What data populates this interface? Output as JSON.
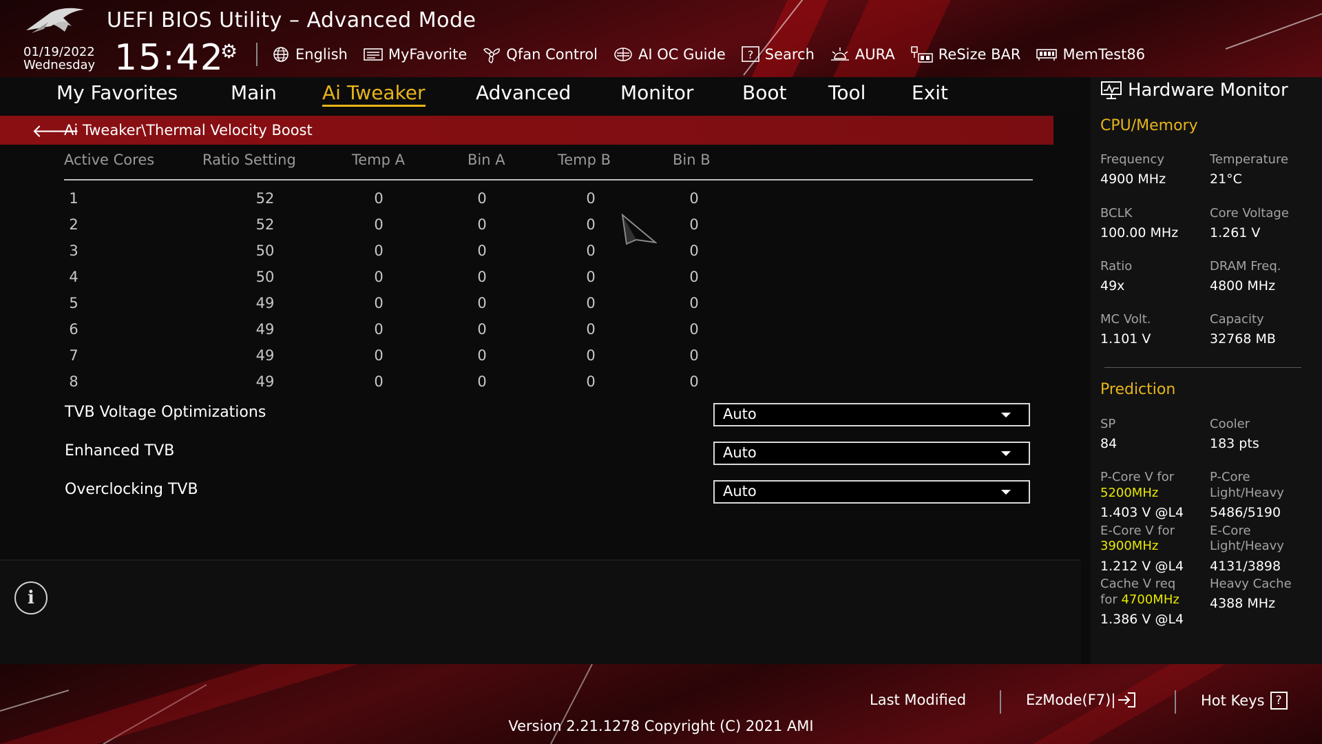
{
  "header": {
    "app_title": "UEFI BIOS Utility – Advanced Mode",
    "date": "01/19/2022",
    "weekday": "Wednesday",
    "time": "15:42",
    "toolbar": [
      {
        "label": "English",
        "icon": "globe-icon"
      },
      {
        "label": "MyFavorite",
        "icon": "favorite-icon"
      },
      {
        "label": "Qfan Control",
        "icon": "fan-icon"
      },
      {
        "label": "AI OC Guide",
        "icon": "ai-oc-guide-icon"
      },
      {
        "label": "Search",
        "icon": "search-icon"
      },
      {
        "label": "AURA",
        "icon": "aura-icon"
      },
      {
        "label": "ReSize BAR",
        "icon": "resize-bar-icon"
      },
      {
        "label": "MemTest86",
        "icon": "memtest-icon"
      }
    ]
  },
  "nav": {
    "tabs": [
      "My Favorites",
      "Main",
      "Ai Tweaker",
      "Advanced",
      "Monitor",
      "Boot",
      "Tool",
      "Exit"
    ],
    "active": "Ai Tweaker"
  },
  "breadcrumb": "Ai Tweaker\\Thermal Velocity Boost",
  "table": {
    "headers": [
      "Active Cores",
      "Ratio Setting",
      "Temp A",
      "Bin A",
      "Temp B",
      "Bin B"
    ],
    "rows": [
      [
        "1",
        "52",
        "0",
        "0",
        "0",
        "0"
      ],
      [
        "2",
        "52",
        "0",
        "0",
        "0",
        "0"
      ],
      [
        "3",
        "50",
        "0",
        "0",
        "0",
        "0"
      ],
      [
        "4",
        "50",
        "0",
        "0",
        "0",
        "0"
      ],
      [
        "5",
        "49",
        "0",
        "0",
        "0",
        "0"
      ],
      [
        "6",
        "49",
        "0",
        "0",
        "0",
        "0"
      ],
      [
        "7",
        "49",
        "0",
        "0",
        "0",
        "0"
      ],
      [
        "8",
        "49",
        "0",
        "0",
        "0",
        "0"
      ]
    ]
  },
  "settings": [
    {
      "label": "TVB Voltage Optimizations",
      "value": "Auto"
    },
    {
      "label": "Enhanced TVB",
      "value": "Auto"
    },
    {
      "label": "Overclocking TVB",
      "value": "Auto"
    }
  ],
  "hardware_monitor": {
    "title": "Hardware Monitor",
    "cpu_memory": {
      "section": "CPU/Memory",
      "frequency_label": "Frequency",
      "frequency": "4900 MHz",
      "temperature_label": "Temperature",
      "temperature": "21°C",
      "bclk_label": "BCLK",
      "bclk": "100.00 MHz",
      "core_voltage_label": "Core Voltage",
      "core_voltage": "1.261 V",
      "ratio_label": "Ratio",
      "ratio": "49x",
      "dram_freq_label": "DRAM Freq.",
      "dram_freq": "4800 MHz",
      "mc_volt_label": "MC Volt.",
      "mc_volt": "1.101 V",
      "capacity_label": "Capacity",
      "capacity": "32768 MB"
    },
    "prediction": {
      "section": "Prediction",
      "sp_label": "SP",
      "sp": "84",
      "cooler_label": "Cooler",
      "cooler": "183 pts",
      "pcore_v_label": "P-Core V for",
      "pcore_v_freq": "5200MHz",
      "pcore_v": "1.403 V @L4",
      "pcore_lh_label_1": "P-Core",
      "pcore_lh_label_2": "Light/Heavy",
      "pcore_lh": "5486/5190",
      "ecore_v_label": "E-Core V for",
      "ecore_v_freq": "3900MHz",
      "ecore_v": "1.212 V @L4",
      "ecore_lh_label_1": "E-Core",
      "ecore_lh_label_2": "Light/Heavy",
      "ecore_lh": "4131/3898",
      "cache_v_label_1": "Cache V req",
      "cache_v_label_2": "for",
      "cache_v_freq": "4700MHz",
      "cache_v": "1.386 V @L4",
      "heavy_cache_label": "Heavy Cache",
      "heavy_cache": "4388 MHz"
    }
  },
  "footer": {
    "last_modified": "Last Modified",
    "ezmode": "EzMode(F7)|",
    "hotkeys": "Hot Keys",
    "hotkeys_key": "?",
    "version": "Version 2.21.1278 Copyright (C) 2021 AMI"
  },
  "colors": {
    "accent": "#e8b51a",
    "breadcrumb_bg": "#8a0f13",
    "highlight_freq": "#e8e800"
  }
}
